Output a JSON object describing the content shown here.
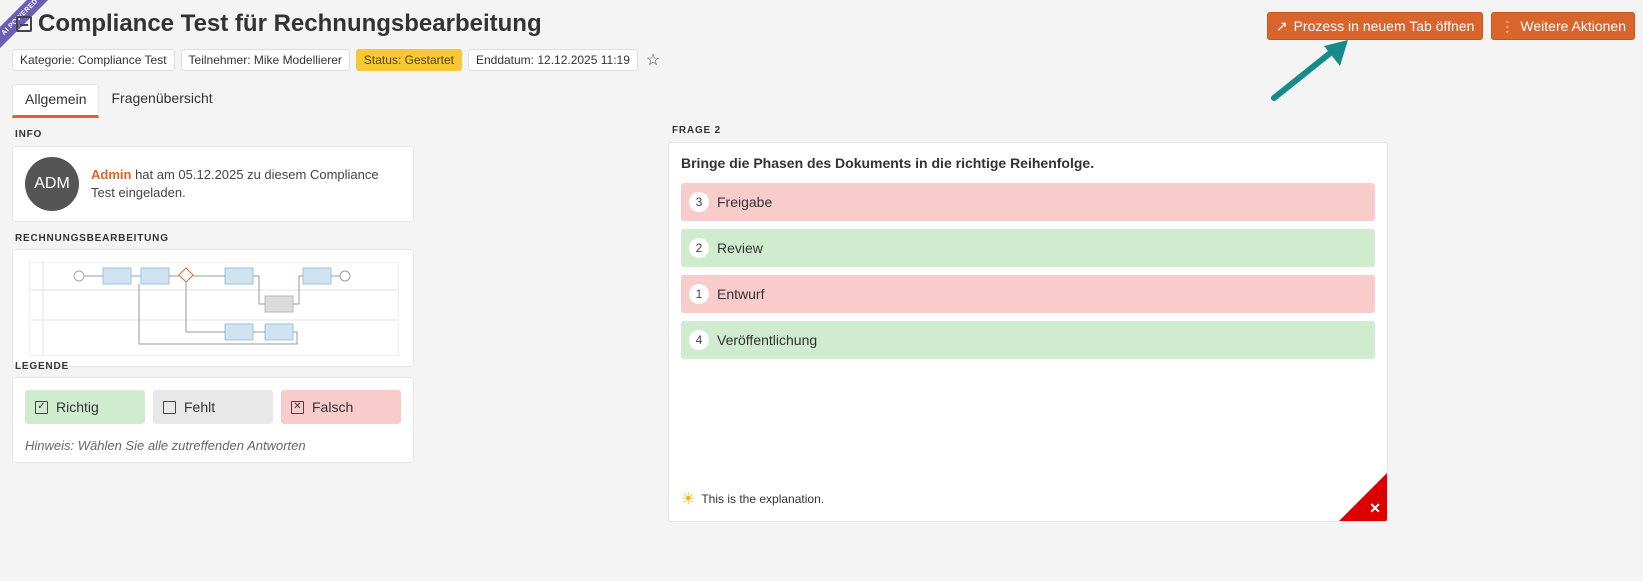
{
  "ribbon": "AI POWERED",
  "title": "Compliance Test für Rechnungsbearbeitung",
  "actions": {
    "open_tab_label": "Prozess in neuem Tab öffnen",
    "more_actions_label": "Weitere Aktionen"
  },
  "badges": {
    "category": "Kategorie: Compliance Test",
    "participant": "Teilnehmer: Mike Modellierer",
    "status": "Status: Gestartet",
    "end_date": "Enddatum: 12.12.2025 11:19"
  },
  "tabs": [
    "Allgemein",
    "Fragenübersicht"
  ],
  "info": {
    "section_label": "INFO",
    "avatar_initials": "ADM",
    "admin_name": "Admin",
    "message": " hat am 05.12.2025 zu diesem Compliance Test eingeladen."
  },
  "process": {
    "section_label": "RECHNUNGSBEARBEITUNG"
  },
  "legend": {
    "section_label": "LEGENDE",
    "correct": "Richtig",
    "missing": "Fehlt",
    "wrong": "Falsch",
    "hint": "Hinweis: Wählen Sie alle zutreffenden Antworten"
  },
  "question": {
    "section_label": "FRAGE 2",
    "text": "Bringe die Phasen des Dokuments in die richtige Reihenfolge.",
    "answers": [
      {
        "number": "3",
        "label": "Freigabe",
        "state": "wrong"
      },
      {
        "number": "2",
        "label": "Review",
        "state": "right"
      },
      {
        "number": "1",
        "label": "Entwurf",
        "state": "wrong"
      },
      {
        "number": "4",
        "label": "Veröffentlichung",
        "state": "right"
      }
    ],
    "explanation": "This is the explanation."
  },
  "colors": {
    "accent": "#d9652d",
    "status": "#f6c836",
    "correct": "#cfeccf",
    "wrong": "#f9cccc",
    "arrow": "#178a8a"
  }
}
